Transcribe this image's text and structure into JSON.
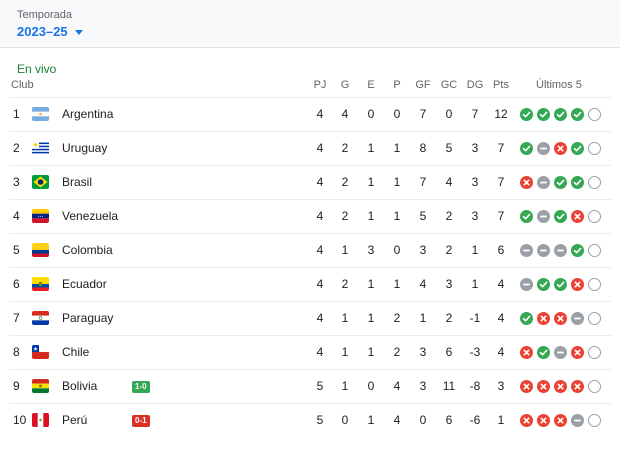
{
  "season": {
    "label": "Temporada",
    "value": "2023–25"
  },
  "status": "En vivo",
  "columns": {
    "club": "Club",
    "pj": "PJ",
    "g": "G",
    "e": "E",
    "p": "P",
    "gf": "GF",
    "gc": "GC",
    "dg": "DG",
    "pts": "Pts",
    "last5": "Últimos 5"
  },
  "colors": {
    "win": "#34a853",
    "loss": "#ea4335",
    "draw": "#9aa0a6",
    "accent": "#1a73e8",
    "live": "#188038"
  },
  "rows": [
    {
      "pos": "1",
      "team": "Argentina",
      "flag": "flag-argentina",
      "badge": "",
      "pj": "4",
      "g": "4",
      "e": "0",
      "p": "0",
      "gf": "7",
      "gc": "0",
      "dg": "7",
      "pts": "12",
      "form": [
        "W",
        "W",
        "W",
        "W",
        "N"
      ]
    },
    {
      "pos": "2",
      "team": "Uruguay",
      "flag": "flag-uruguay",
      "badge": "",
      "pj": "4",
      "g": "2",
      "e": "1",
      "p": "1",
      "gf": "8",
      "gc": "5",
      "dg": "3",
      "pts": "7",
      "form": [
        "W",
        "D",
        "L",
        "W",
        "N"
      ]
    },
    {
      "pos": "3",
      "team": "Brasil",
      "flag": "flag-brazil",
      "badge": "",
      "pj": "4",
      "g": "2",
      "e": "1",
      "p": "1",
      "gf": "7",
      "gc": "4",
      "dg": "3",
      "pts": "7",
      "form": [
        "L",
        "D",
        "W",
        "W",
        "N"
      ]
    },
    {
      "pos": "4",
      "team": "Venezuela",
      "flag": "flag-venezuela",
      "badge": "",
      "pj": "4",
      "g": "2",
      "e": "1",
      "p": "1",
      "gf": "5",
      "gc": "2",
      "dg": "3",
      "pts": "7",
      "form": [
        "W",
        "D",
        "W",
        "L",
        "N"
      ]
    },
    {
      "pos": "5",
      "team": "Colombia",
      "flag": "flag-colombia",
      "badge": "",
      "pj": "4",
      "g": "1",
      "e": "3",
      "p": "0",
      "gf": "3",
      "gc": "2",
      "dg": "1",
      "pts": "6",
      "form": [
        "D",
        "D",
        "D",
        "W",
        "N"
      ]
    },
    {
      "pos": "6",
      "team": "Ecuador",
      "flag": "flag-ecuador",
      "badge": "",
      "pj": "4",
      "g": "2",
      "e": "1",
      "p": "1",
      "gf": "4",
      "gc": "3",
      "dg": "1",
      "pts": "4",
      "form": [
        "D",
        "W",
        "W",
        "L",
        "N"
      ]
    },
    {
      "pos": "7",
      "team": "Paraguay",
      "flag": "flag-paraguay",
      "badge": "",
      "pj": "4",
      "g": "1",
      "e": "1",
      "p": "2",
      "gf": "1",
      "gc": "2",
      "dg": "-1",
      "pts": "4",
      "form": [
        "W",
        "L",
        "L",
        "D",
        "N"
      ]
    },
    {
      "pos": "8",
      "team": "Chile",
      "flag": "flag-chile",
      "badge": "",
      "pj": "4",
      "g": "1",
      "e": "1",
      "p": "2",
      "gf": "3",
      "gc": "6",
      "dg": "-3",
      "pts": "4",
      "form": [
        "L",
        "W",
        "D",
        "L",
        "N"
      ]
    },
    {
      "pos": "9",
      "team": "Bolivia",
      "flag": "flag-bolivia",
      "badge": "1-0",
      "badge_color": "#34a853",
      "pj": "5",
      "g": "1",
      "e": "0",
      "p": "4",
      "gf": "3",
      "gc": "11",
      "dg": "-8",
      "pts": "3",
      "form": [
        "L",
        "L",
        "L",
        "L",
        "N"
      ]
    },
    {
      "pos": "10",
      "team": "Perú",
      "flag": "flag-peru",
      "badge": "0-1",
      "badge_color": "#d93025",
      "pj": "5",
      "g": "0",
      "e": "1",
      "p": "4",
      "gf": "0",
      "gc": "6",
      "dg": "-6",
      "pts": "1",
      "form": [
        "L",
        "L",
        "L",
        "D",
        "N"
      ]
    }
  ]
}
